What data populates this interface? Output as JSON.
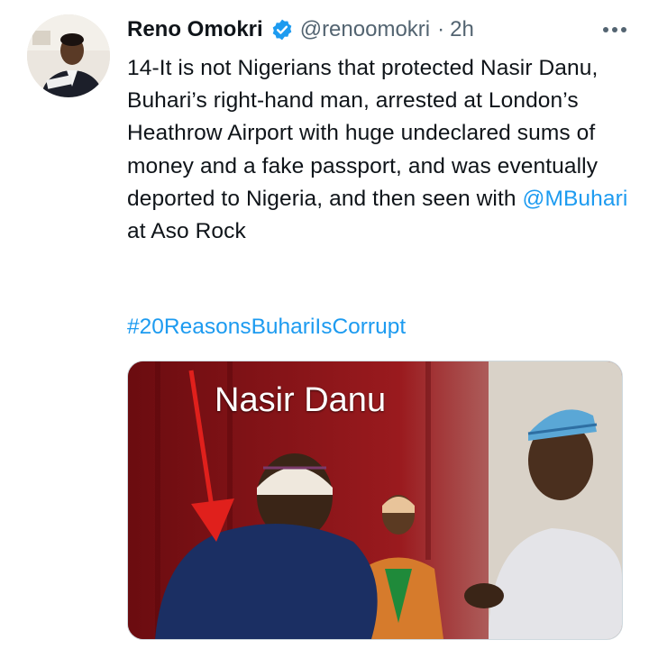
{
  "tweet": {
    "author_name": "Reno Omokri",
    "handle": "@renoomokri",
    "separator": "·",
    "time": "2h",
    "body_before_mention": "14-It is not Nigerians that protected Nasir Danu, Buhari’s right-hand man, arrested at London’s Heathrow Airport with huge undeclared sums of money and a fake passport, and was eventually deported to Nigeria, and then seen with ",
    "mention": "@MBuhari",
    "body_after_mention": " at Aso Rock",
    "hashtag": "#20ReasonsBuhariIsCorrupt",
    "media_caption": "Nasir Danu"
  },
  "colors": {
    "link": "#1d9bf0",
    "verified": "#1d9bf0",
    "secondary_text": "#536471",
    "arrow": "#e0201c"
  },
  "icons": {
    "verified": "verified-badge-icon",
    "more": "more-options-icon"
  }
}
